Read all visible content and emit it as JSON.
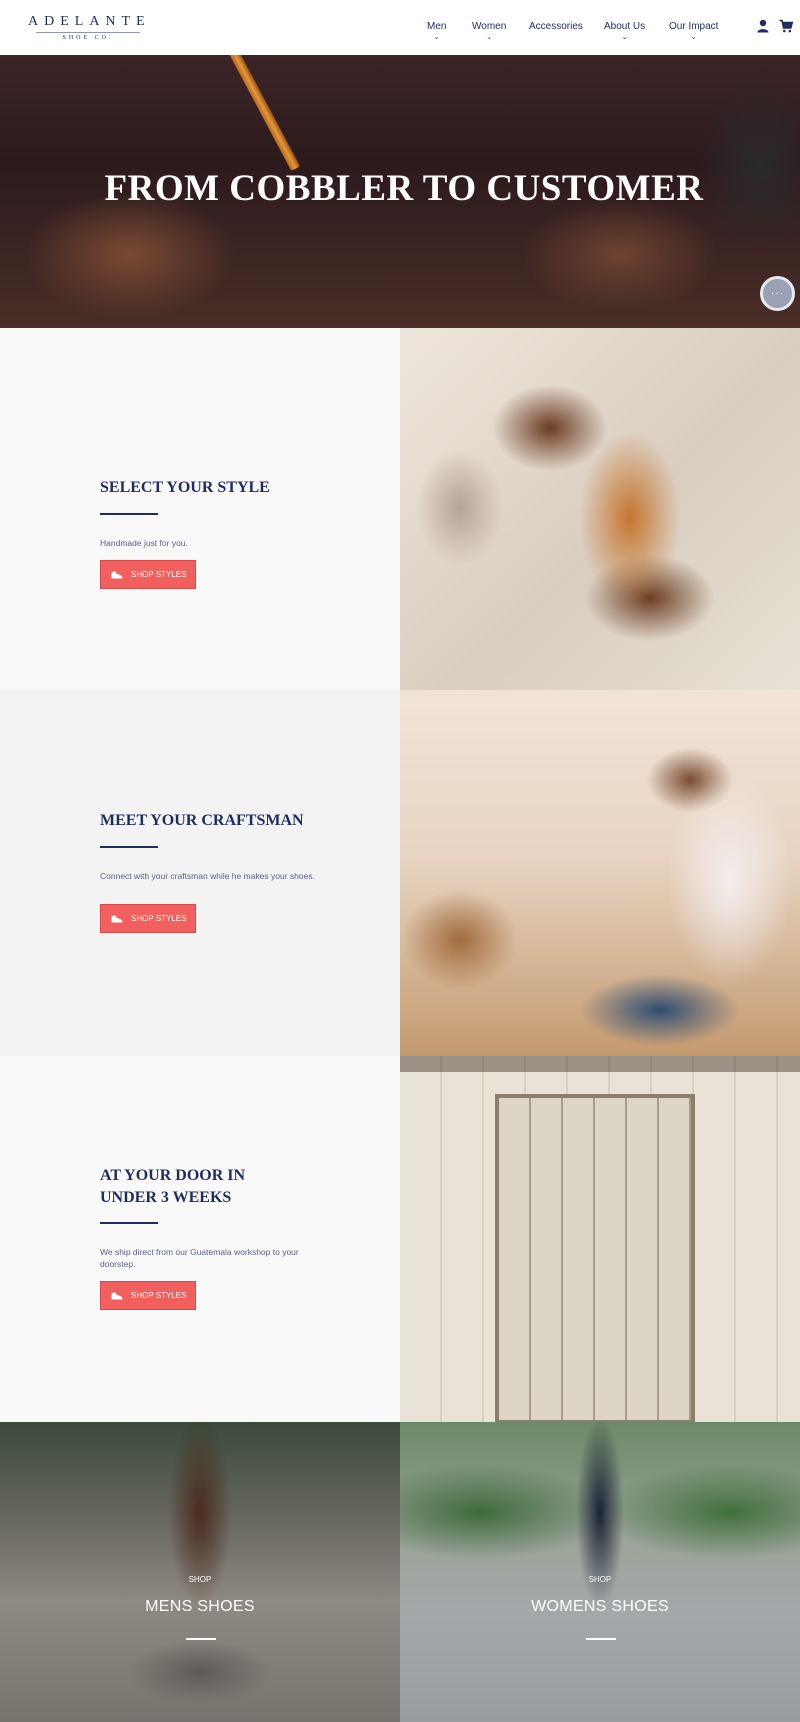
{
  "brand": {
    "name": "ADELANTE",
    "sub": "SHOE CO."
  },
  "nav": [
    {
      "label": "Men",
      "has_menu": true
    },
    {
      "label": "Women",
      "has_menu": true
    },
    {
      "label": "Accessories",
      "has_menu": false
    },
    {
      "label": "About Us",
      "has_menu": true
    },
    {
      "label": "Our Impact",
      "has_menu": true
    }
  ],
  "header_icons": [
    "user-icon",
    "cart-icon"
  ],
  "hero": {
    "title": "FROM COBBLER TO CUSTOMER"
  },
  "chat": {
    "icon": "chat-bubble-icon",
    "glyph": "···"
  },
  "features": [
    {
      "title": "SELECT YOUR STYLE",
      "text": "Handmade just for you.",
      "button": "SHOP STYLES"
    },
    {
      "title": "MEET YOUR CRAFTSMAN",
      "text": "Connect with your craftsman while he makes your shoes.",
      "button": "SHOP STYLES"
    },
    {
      "title": "AT YOUR DOOR IN UNDER 3 WEEKS",
      "text": "We ship direct from our Guatemala workshop to your doorstep.",
      "button": "SHOP STYLES"
    }
  ],
  "categories": [
    {
      "pre": "SHOP",
      "title": "MENS SHOES"
    },
    {
      "pre": "SHOP",
      "title": "WOMENS SHOES"
    }
  ],
  "colors": {
    "navy": "#1f2d5c",
    "accent": "#f1605e",
    "panel_light": "#f9f9f9",
    "panel_mid": "#f3f3f3"
  }
}
